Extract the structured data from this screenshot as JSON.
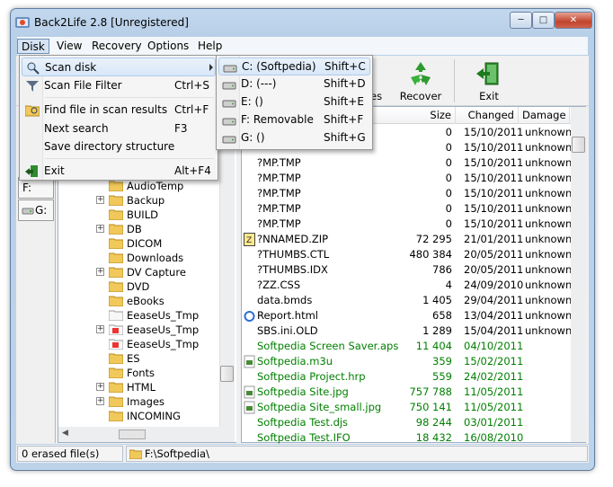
{
  "window": {
    "title": "Back2Life 2.8 [Unregistered]",
    "watermark": "Softpedia"
  },
  "menubar": {
    "items": [
      "Disk",
      "View",
      "Recovery",
      "Options",
      "Help"
    ]
  },
  "toolbar": {
    "partial_label": "es",
    "recover_label": "Recover",
    "exit_label": "Exit"
  },
  "drives": {
    "f": "F:",
    "g": "G:"
  },
  "disk_menu": {
    "items": [
      {
        "label": "Scan disk",
        "shortcut": "",
        "icon": "scan-disk-icon",
        "submenu": true
      },
      {
        "label": "Scan File Filter",
        "shortcut": "Ctrl+S",
        "icon": "filter-icon"
      },
      {
        "label": "Find file in scan results",
        "shortcut": "Ctrl+F",
        "icon": "find-icon"
      },
      {
        "label": "Next search",
        "shortcut": "F3",
        "icon": ""
      },
      {
        "label": "Save directory structure",
        "shortcut": "",
        "icon": ""
      },
      {
        "label": "Exit",
        "shortcut": "Alt+F4",
        "icon": "exit-icon"
      }
    ]
  },
  "scan_submenu": {
    "items": [
      {
        "label": "C: (Softpedia)",
        "shortcut": "Shift+C"
      },
      {
        "label": "D: (---)",
        "shortcut": "Shift+D"
      },
      {
        "label": "E: ()",
        "shortcut": "Shift+E"
      },
      {
        "label": "F: Removable",
        "shortcut": "Shift+F"
      },
      {
        "label": "G: ()",
        "shortcut": "Shift+G"
      }
    ]
  },
  "tree": {
    "items": [
      {
        "label": "AudioTemp",
        "expand": false,
        "type": "folder"
      },
      {
        "label": "Backup",
        "expand": true,
        "type": "folder"
      },
      {
        "label": "BUILD",
        "expand": false,
        "type": "folder"
      },
      {
        "label": "DB",
        "expand": true,
        "type": "folder"
      },
      {
        "label": "DICOM",
        "expand": false,
        "type": "folder"
      },
      {
        "label": "Downloads",
        "expand": false,
        "type": "folder"
      },
      {
        "label": "DV Capture",
        "expand": true,
        "type": "folder"
      },
      {
        "label": "DVD",
        "expand": false,
        "type": "folder"
      },
      {
        "label": "eBooks",
        "expand": false,
        "type": "folder"
      },
      {
        "label": "EeaseUs_Tmp",
        "expand": false,
        "type": "folder-open"
      },
      {
        "label": "EeaseUs_Tmp",
        "expand": true,
        "type": "folder-deleted"
      },
      {
        "label": "EeaseUs_Tmp",
        "expand": false,
        "type": "folder-deleted"
      },
      {
        "label": "ES",
        "expand": false,
        "type": "folder"
      },
      {
        "label": "Fonts",
        "expand": false,
        "type": "folder"
      },
      {
        "label": "HTML",
        "expand": true,
        "type": "folder"
      },
      {
        "label": "Images",
        "expand": true,
        "type": "folder"
      },
      {
        "label": "INCOMING",
        "expand": false,
        "type": "folder"
      }
    ]
  },
  "list": {
    "columns": {
      "size": "Size",
      "changed": "Changed",
      "damage": "Damage"
    },
    "rows": [
      {
        "name": "",
        "size": "0",
        "date": "15/10/2011",
        "damage": "unknown",
        "color": "#000000",
        "icon": "file-icon"
      },
      {
        "name": "",
        "size": "0",
        "date": "15/10/2011",
        "damage": "unknown",
        "color": "#000000",
        "icon": "file-icon"
      },
      {
        "name": "?MP.TMP",
        "size": "0",
        "date": "15/10/2011",
        "damage": "unknown",
        "color": "#000000",
        "icon": "file-icon"
      },
      {
        "name": "?MP.TMP",
        "size": "0",
        "date": "15/10/2011",
        "damage": "unknown",
        "color": "#000000",
        "icon": "file-icon"
      },
      {
        "name": "?MP.TMP",
        "size": "0",
        "date": "15/10/2011",
        "damage": "unknown",
        "color": "#000000",
        "icon": "file-icon"
      },
      {
        "name": "?MP.TMP",
        "size": "0",
        "date": "15/10/2011",
        "damage": "unknown",
        "color": "#000000",
        "icon": "file-icon"
      },
      {
        "name": "?MP.TMP",
        "size": "0",
        "date": "15/10/2011",
        "damage": "unknown",
        "color": "#000000",
        "icon": "file-icon"
      },
      {
        "name": "?NNAMED.ZIP",
        "size": "72 295",
        "date": "21/01/2011",
        "damage": "unknown",
        "color": "#000000",
        "icon": "zip-icon"
      },
      {
        "name": "?THUMBS.CTL",
        "size": "480 384",
        "date": "20/05/2011",
        "damage": "unknown",
        "color": "#000000",
        "icon": "file-icon"
      },
      {
        "name": "?THUMBS.IDX",
        "size": "786",
        "date": "20/05/2011",
        "damage": "unknown",
        "color": "#000000",
        "icon": "file-icon"
      },
      {
        "name": "?ZZ.CSS",
        "size": "4",
        "date": "24/09/2010",
        "damage": "unknown",
        "color": "#000000",
        "icon": "file-icon"
      },
      {
        "name": "data.bmds",
        "size": "1 405",
        "date": "29/04/2011",
        "damage": "unknown",
        "color": "#000000",
        "icon": "file-icon"
      },
      {
        "name": "Report.html",
        "size": "658",
        "date": "13/04/2011",
        "damage": "unknown",
        "color": "#000000",
        "icon": "html-icon"
      },
      {
        "name": "SBS.ini.OLD",
        "size": "1 289",
        "date": "15/04/2011",
        "damage": "unknown",
        "color": "#000000",
        "icon": "file-icon"
      },
      {
        "name": "Softpedia Screen Saver.aps",
        "size": "11 404",
        "date": "04/10/2011",
        "damage": "",
        "color": "#008000",
        "icon": "file-icon"
      },
      {
        "name": "Softpedia.m3u",
        "size": "359",
        "date": "15/02/2011",
        "damage": "",
        "color": "#008000",
        "icon": "media-icon"
      },
      {
        "name": "Softpedia Project.hrp",
        "size": "559",
        "date": "24/02/2011",
        "damage": "",
        "color": "#008000",
        "icon": "file-icon"
      },
      {
        "name": "Softpedia Site.jpg",
        "size": "757 788",
        "date": "11/05/2011",
        "damage": "",
        "color": "#008000",
        "icon": "image-icon"
      },
      {
        "name": "Softpedia Site_small.jpg",
        "size": "750 141",
        "date": "11/05/2011",
        "damage": "",
        "color": "#008000",
        "icon": "image-icon"
      },
      {
        "name": "Softpedia Test.djs",
        "size": "98 244",
        "date": "03/01/2011",
        "damage": "",
        "color": "#008000",
        "icon": "file-icon"
      },
      {
        "name": "Softpedia Test.IFO",
        "size": "18 432",
        "date": "16/08/2010",
        "damage": "",
        "color": "#008000",
        "icon": "file-icon"
      }
    ]
  },
  "status": {
    "erased": "0  erased file(s)",
    "path": "F:\\Softpedia\\"
  }
}
